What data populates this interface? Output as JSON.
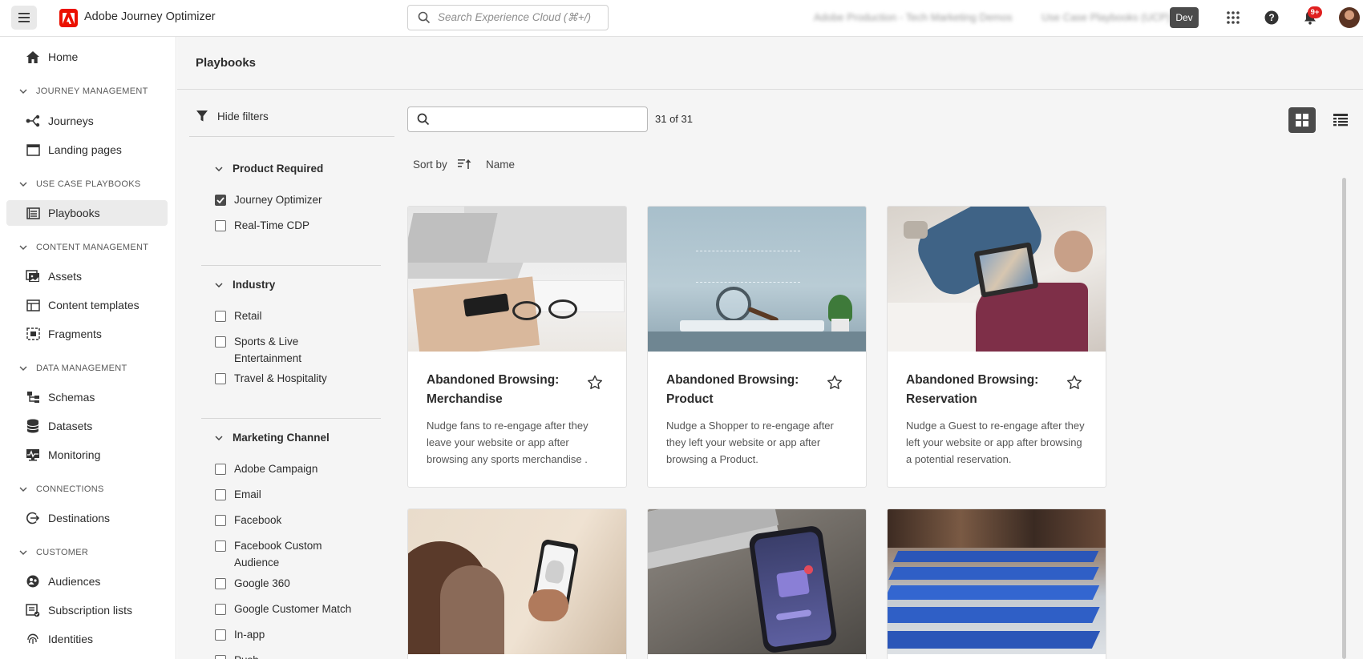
{
  "topbar": {
    "app_title": "Adobe Journey Optimizer",
    "search_placeholder": "Search Experience Cloud (⌘+/)",
    "org_name": "Adobe Production - Tech Marketing Demos",
    "sandbox_name": "Use Case Playbooks (UCP)",
    "env_badge": "Dev",
    "notification_count": "9+"
  },
  "nav": {
    "home": "Home",
    "sections": {
      "journey_management": "JOURNEY MANAGEMENT",
      "use_case_playbooks": "USE CASE PLAYBOOKS",
      "content_management": "CONTENT MANAGEMENT",
      "data_management": "DATA MANAGEMENT",
      "connections": "CONNECTIONS",
      "customer": "CUSTOMER"
    },
    "items": {
      "journeys": "Journeys",
      "landing_pages": "Landing pages",
      "playbooks": "Playbooks",
      "assets": "Assets",
      "content_templates": "Content templates",
      "fragments": "Fragments",
      "schemas": "Schemas",
      "datasets": "Datasets",
      "monitoring": "Monitoring",
      "destinations": "Destinations",
      "audiences": "Audiences",
      "subscription_lists": "Subscription lists",
      "identities": "Identities"
    }
  },
  "page": {
    "title": "Playbooks",
    "hide_filters": "Hide filters",
    "result_count": "31 of 31",
    "sort_by_label": "Sort by",
    "sort_value": "Name",
    "search_value": ""
  },
  "filters": {
    "product_required": {
      "heading": "Product Required",
      "options": [
        {
          "label": "Journey Optimizer",
          "checked": true
        },
        {
          "label": "Real-Time CDP",
          "checked": false
        }
      ]
    },
    "industry": {
      "heading": "Industry",
      "options": [
        {
          "label": "Retail",
          "checked": false
        },
        {
          "label": "Sports & Live Entertainment",
          "checked": false
        },
        {
          "label": "Travel & Hospitality",
          "checked": false
        }
      ]
    },
    "marketing_channel": {
      "heading": "Marketing Channel",
      "options": [
        {
          "label": "Adobe Campaign",
          "checked": false
        },
        {
          "label": "Email",
          "checked": false
        },
        {
          "label": "Facebook",
          "checked": false
        },
        {
          "label": "Facebook Custom Audience",
          "checked": false
        },
        {
          "label": "Google 360",
          "checked": false
        },
        {
          "label": "Google Customer Match",
          "checked": false
        },
        {
          "label": "In-app",
          "checked": false
        },
        {
          "label": "Push",
          "checked": false
        }
      ]
    }
  },
  "cards": [
    {
      "title": "Abandoned Browsing: Merchandise",
      "description": "Nudge fans to re-engage after they leave your website or app after browsing any sports merchandise ."
    },
    {
      "title": "Abandoned Browsing: Product",
      "description": "Nudge a Shopper to re-engage after they left your website or app after browsing a Product."
    },
    {
      "title": "Abandoned Browsing: Reservation",
      "description": "Nudge a Guest to re-engage after they left your website or app after browsing a potential reservation."
    }
  ],
  "colors": {
    "brand_red": "#eb1000",
    "selected_dark": "#4b4b4b",
    "page_bg": "#f5f5f5"
  },
  "icons": [
    "menu-icon",
    "adobe-logo-icon",
    "search-icon",
    "apps-grid-icon",
    "help-icon",
    "bell-icon",
    "home-icon",
    "journey-icon",
    "landing-page-icon",
    "playbook-icon",
    "assets-icon",
    "template-icon",
    "fragment-icon",
    "schema-icon",
    "dataset-icon",
    "monitoring-icon",
    "destination-icon",
    "audience-icon",
    "subscription-icon",
    "identity-icon",
    "filter-icon",
    "sort-icon",
    "grid-view-icon",
    "list-view-icon",
    "star-icon",
    "chevron-down-icon"
  ]
}
